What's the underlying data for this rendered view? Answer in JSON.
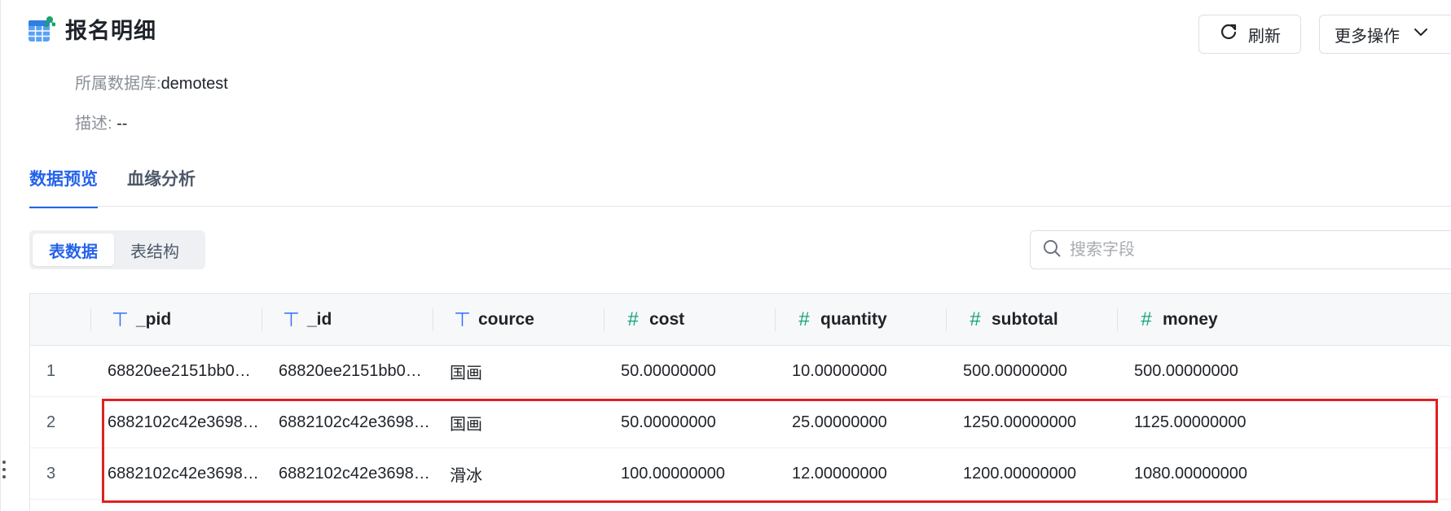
{
  "header": {
    "title": "报名明细",
    "db_label": "所属数据库:",
    "db_value": "demotest",
    "desc_label": "描述:",
    "desc_value": " --"
  },
  "actions": {
    "refresh": "刷新",
    "more": "更多操作"
  },
  "tabs": [
    {
      "label": "数据预览",
      "active": true
    },
    {
      "label": "血缘分析",
      "active": false
    }
  ],
  "segment": [
    {
      "label": "表数据",
      "active": true
    },
    {
      "label": "表结构",
      "active": false
    }
  ],
  "search": {
    "placeholder": "搜索字段"
  },
  "table": {
    "columns": [
      {
        "name": "_pid",
        "type": "text",
        "type_icon": "⊤"
      },
      {
        "name": "_id",
        "type": "text",
        "type_icon": "⊤"
      },
      {
        "name": "cource",
        "type": "text",
        "type_icon": "⊤"
      },
      {
        "name": "cost",
        "type": "number",
        "type_icon": "#"
      },
      {
        "name": "quantity",
        "type": "number",
        "type_icon": "#"
      },
      {
        "name": "subtotal",
        "type": "number",
        "type_icon": "#"
      },
      {
        "name": "money",
        "type": "number",
        "type_icon": "#"
      }
    ],
    "rows": [
      {
        "index": "1",
        "cells": [
          "68820ee2151bb0…",
          "68820ee2151bb0…",
          "国画",
          "50.00000000",
          "10.00000000",
          "500.00000000",
          "500.00000000"
        ]
      },
      {
        "index": "2",
        "cells": [
          "6882102c42e3698…",
          "6882102c42e3698…",
          "国画",
          "50.00000000",
          "25.00000000",
          "1250.00000000",
          "1125.00000000"
        ]
      },
      {
        "index": "3",
        "cells": [
          "6882102c42e3698…",
          "6882102c42e3698…",
          "滑冰",
          "100.00000000",
          "12.00000000",
          "1200.00000000",
          "1080.00000000"
        ]
      }
    ]
  },
  "colors": {
    "accent": "#2563eb",
    "text_type_icon": "#3370ff",
    "number_type_icon": "#14a37f",
    "highlight_box": "#e02020"
  }
}
